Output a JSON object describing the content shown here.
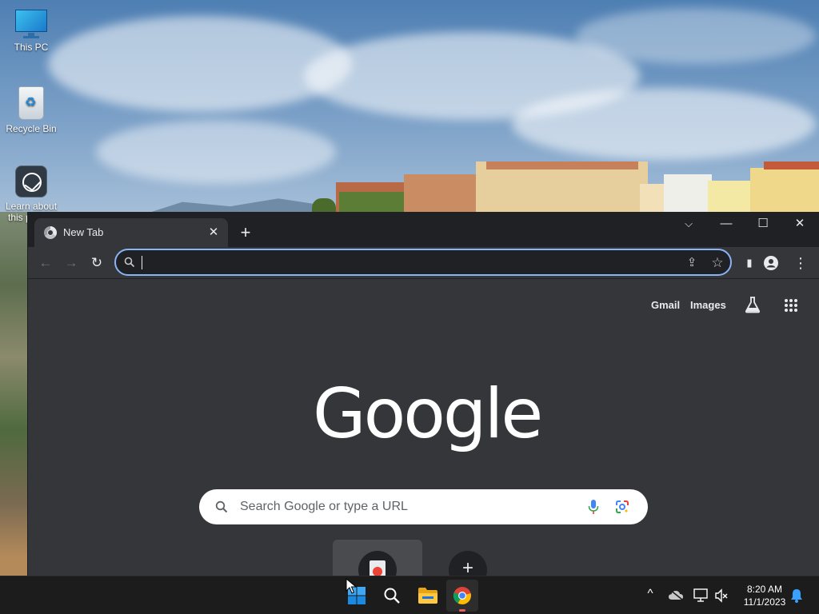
{
  "desktop": {
    "icons": [
      {
        "label": "This PC",
        "icon": "monitor-icon"
      },
      {
        "label": "Recycle Bin",
        "icon": "recycle-bin-icon"
      },
      {
        "label": "Learn about this picture",
        "icon": "learn-about-icon"
      }
    ]
  },
  "browser": {
    "tab": {
      "title": "New Tab",
      "close_glyph": "✕",
      "favicon": "chrome-icon"
    },
    "new_tab_glyph": "+",
    "window_controls": {
      "tab_search": "⌵",
      "minimize": "—",
      "maximize": "☐",
      "close": "✕"
    },
    "toolbar": {
      "back": "←",
      "forward": "→",
      "reload": "↻",
      "omnibox_value": "",
      "share_glyph": "⇪",
      "bookmark_glyph": "☆",
      "side_panel_glyph": "▮",
      "menu_glyph": "⋮"
    },
    "ntp": {
      "gmail": "Gmail",
      "images": "Images",
      "logo": "Google",
      "search_placeholder": "Search Google or type a URL",
      "add_shortcut_glyph": "+"
    }
  },
  "taskbar": {
    "apps": [
      {
        "name": "Start",
        "icon": "windows-start-icon"
      },
      {
        "name": "Search",
        "icon": "search-icon"
      },
      {
        "name": "File Explorer",
        "icon": "folder-icon"
      },
      {
        "name": "Google Chrome",
        "icon": "chrome-icon",
        "active": true
      }
    ],
    "tray": {
      "chevron": "^",
      "time": "8:20 AM",
      "date": "11/1/2023"
    }
  },
  "colors": {
    "chrome_frame": "#202124",
    "chrome_toolbar": "#35363a",
    "omnibox_focus": "#8ab4f8",
    "taskbar": "#1c1c1c",
    "notification_bell": "#3aa0ff"
  }
}
